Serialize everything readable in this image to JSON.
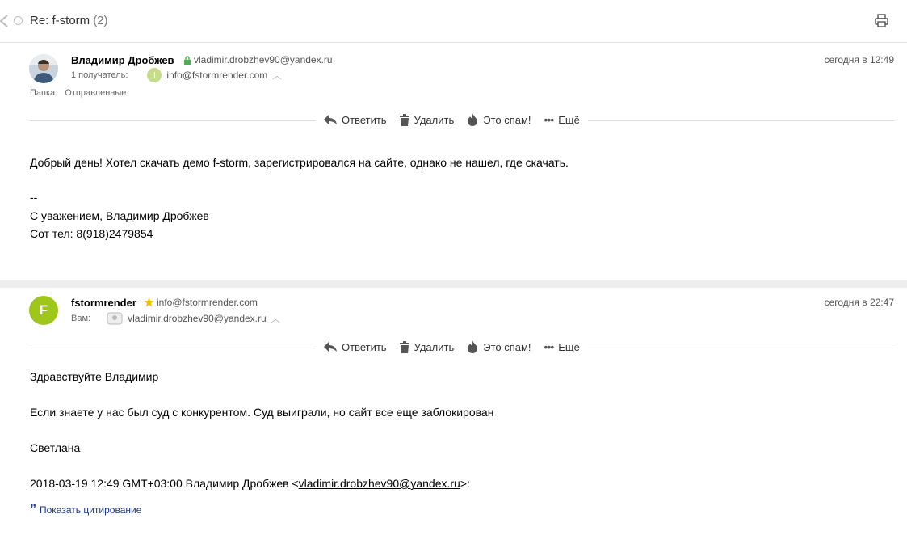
{
  "thread": {
    "subject": "Re: f-storm",
    "count": "(2)"
  },
  "toolbar": {
    "reply": "Ответить",
    "delete": "Удалить",
    "spam": "Это спам!",
    "more": "Ещё"
  },
  "messages": [
    {
      "sender_name": "Владимир Дробжев",
      "sender_email": "vladimir.drobzhev90@yandex.ru",
      "date": "сегодня в 12:49",
      "recipients_label": "1 получатель:",
      "recipient_avatar": "I",
      "recipient_email": "info@fstormrender.com",
      "folder_label": "Папка:",
      "folder_value": "Отправленные",
      "body": [
        "Добрый день! Хотел скачать демо f-storm, зарегистрировался на сайте, однако не нашел, где скачать.",
        "--",
        "С уважением, Владимир Дробжев",
        "Сот тел: 8(918)2479854"
      ]
    },
    {
      "avatar_letter": "F",
      "sender_name": "fstormrender",
      "sender_email": "info@fstormrender.com",
      "date": "сегодня в 22:47",
      "recipients_label": "Вам:",
      "recipient_email": "vladimir.drobzhev90@yandex.ru",
      "body": [
        "Здравствуйте Владимир",
        "Если знаете у нас был суд с конкурентом. Суд выиграли, но сайт все еще заблокирован",
        "Светлана"
      ],
      "quote_header_prefix": "2018-03-19 12:49 GMT+03:00 Владимир Дробжев <",
      "quote_header_link": "vladimir.drobzhev90@yandex.ru",
      "quote_header_suffix": ">:",
      "show_quote": "Показать цитирование"
    }
  ],
  "colors": {
    "accent_green": "#9fc61a",
    "secure_green": "#4caf50",
    "quote_link": "#1a3a8c"
  }
}
